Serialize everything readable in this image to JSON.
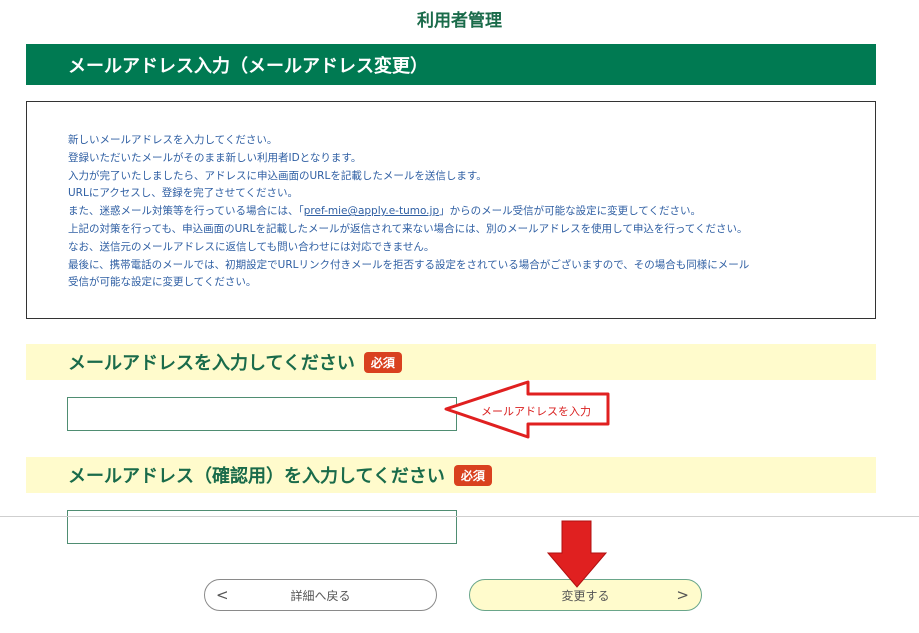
{
  "page": {
    "title": "利用者管理"
  },
  "section": {
    "header": "メールアドレス入力（メールアドレス変更）"
  },
  "notice": {
    "lines": [
      "新しいメールアドレスを入力してください。",
      "登録いただいたメールがそのまま新しい利用者IDとなります。",
      "入力が完了いたしましたら、アドレスに申込画面のURLを記載したメールを送信します。",
      "URLにアクセスし、登録を完了させてください。"
    ],
    "spam_prefix": "また、迷惑メール対策等を行っている場合には、「",
    "spam_link": "pref-mie@apply.e-tumo.jp",
    "spam_suffix": "」からのメール受信が可能な設定に変更してください。",
    "lines_after": [
      "上記の対策を行っても、申込画面のURLを記載したメールが返信されて来ない場合には、別のメールアドレスを使用して申込を行ってください。",
      "なお、送信元のメールアドレスに返信しても問い合わせには対応できません。",
      "最後に、携帯電話のメールでは、初期設定でURLリンク付きメールを拒否する設定をされている場合がございますので、その場合も同様にメール",
      "受信が可能な設定に変更してください。"
    ]
  },
  "email_field": {
    "label": "メールアドレスを入力してください",
    "required": "必須",
    "value": ""
  },
  "confirm_field": {
    "label": "メールアドレス（確認用）を入力してください",
    "required": "必須",
    "value": ""
  },
  "buttons": {
    "back_label": "詳細へ戻る",
    "back_arrow": "<",
    "change_label": "変更する",
    "change_arrow": ">"
  },
  "annotations": {
    "email_hint": "メールアドレスを入力"
  },
  "colors": {
    "brand_green": "#007a52",
    "label_bg": "#fffbcc",
    "required_red": "#d9411f",
    "annotation_red": "#e02020"
  }
}
